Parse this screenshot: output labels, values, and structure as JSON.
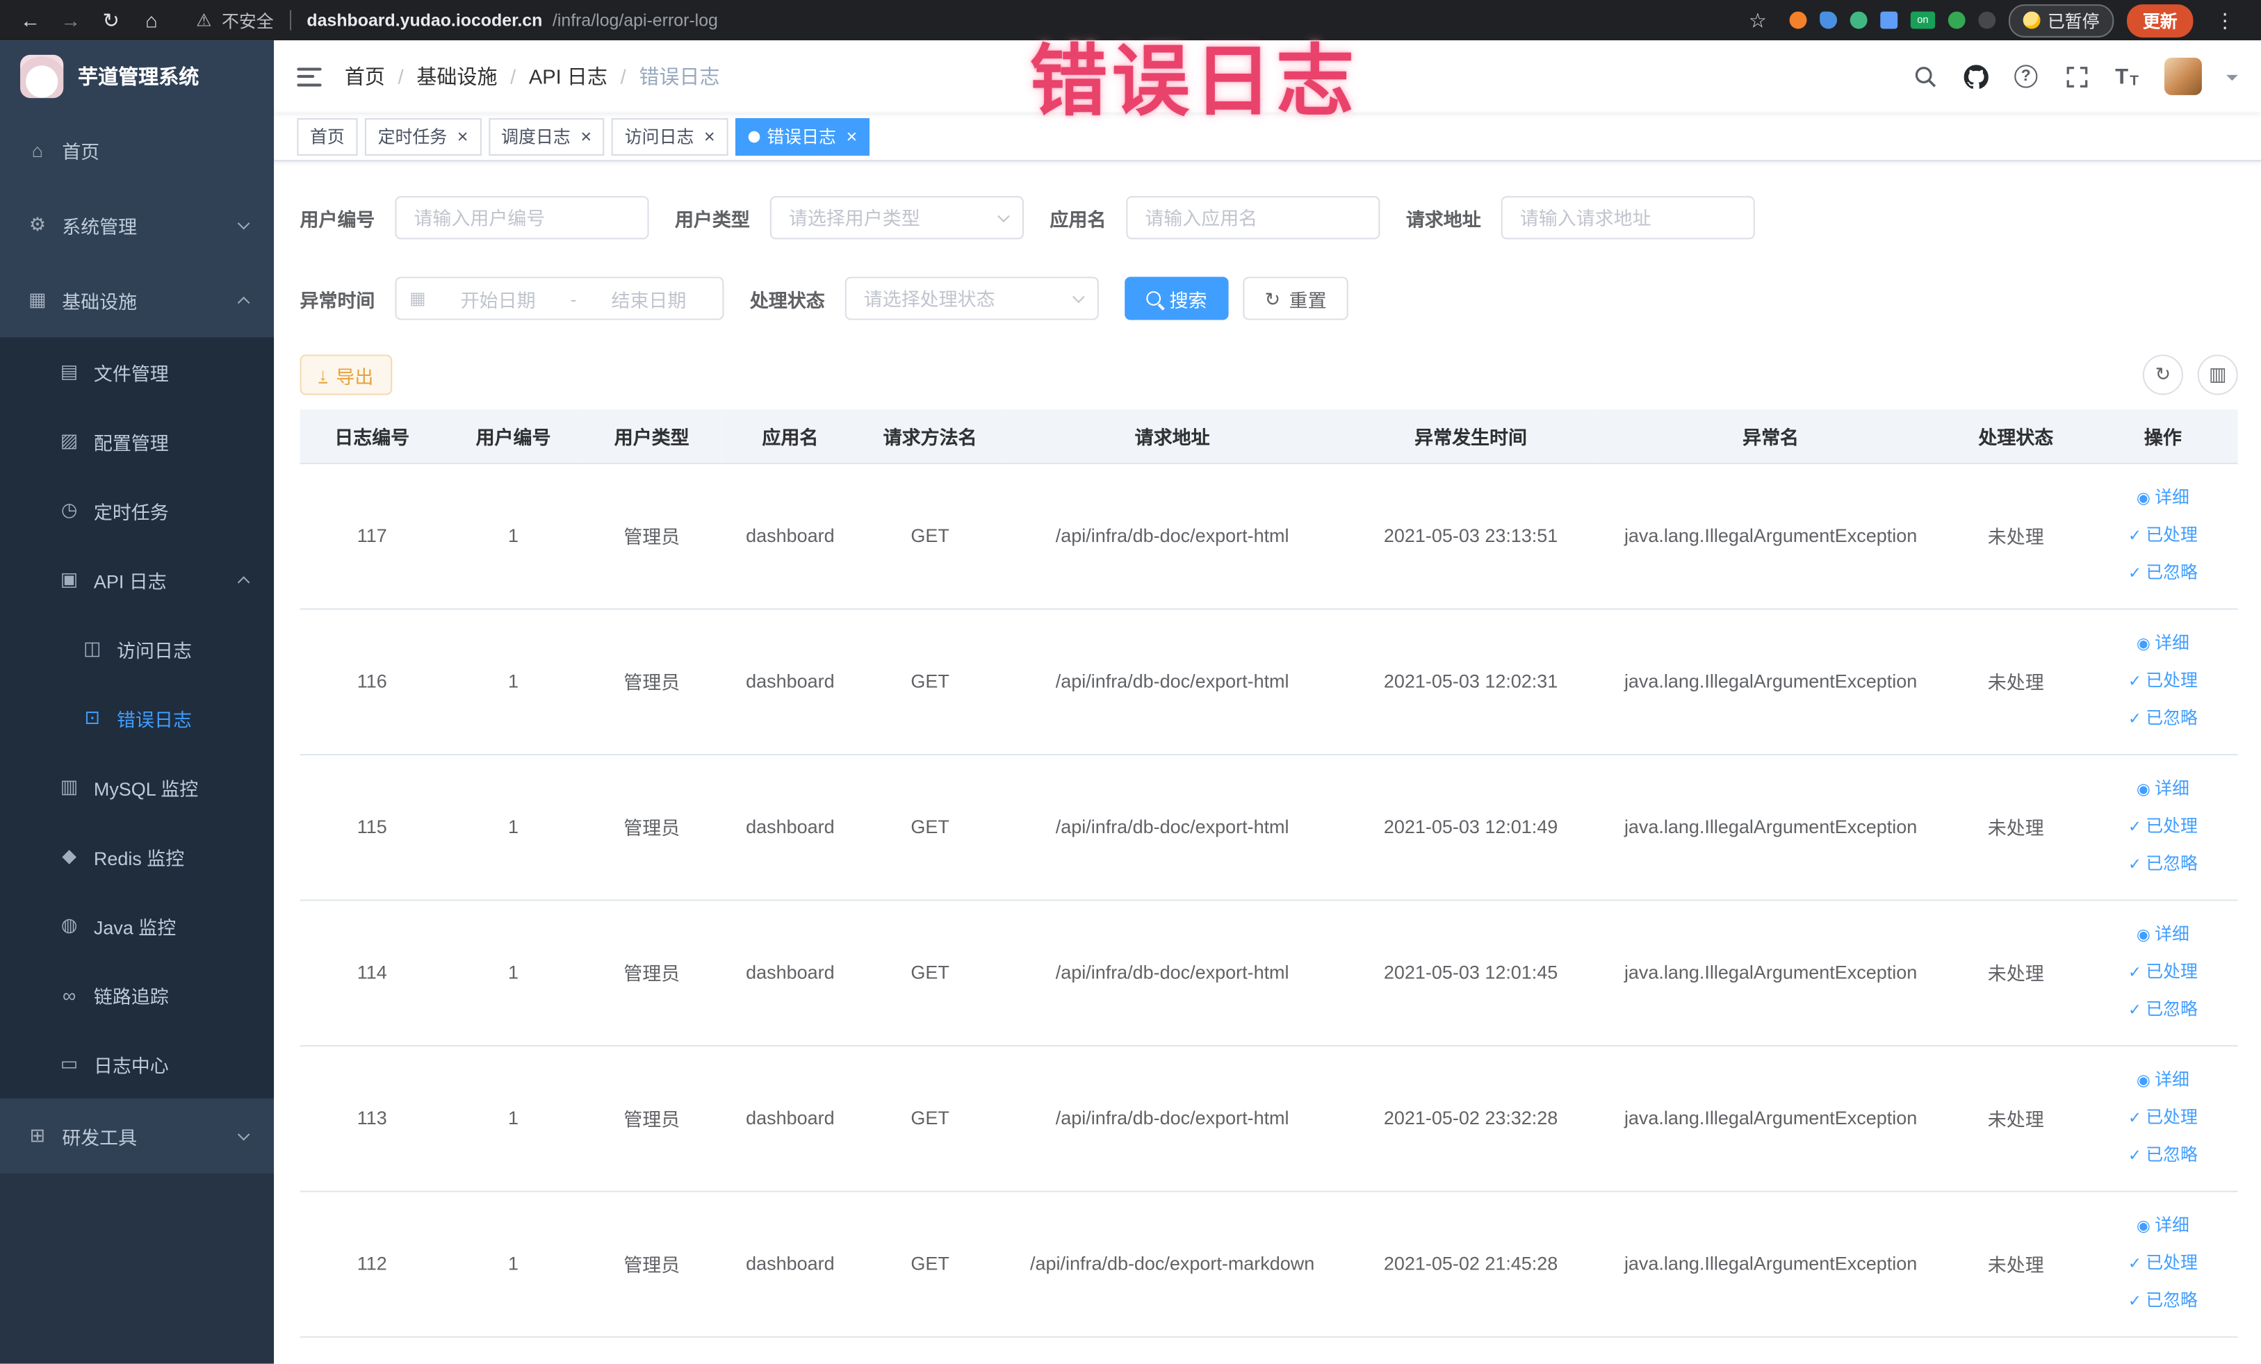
{
  "browser": {
    "security_label": "不安全",
    "url_host": "dashboard.yudao.iocoder.cn",
    "url_path": "/infra/log/api-error-log",
    "on_badge": "on",
    "paused_badge": "已暂停",
    "update_button": "更新"
  },
  "annotation": {
    "overlay_text": "错误日志"
  },
  "sidebar": {
    "logo_title": "芋道管理系统",
    "home": "首页",
    "system": "系统管理",
    "infra": "基础设施",
    "file_mgmt": "文件管理",
    "config_mgmt": "配置管理",
    "scheduled_jobs": "定时任务",
    "api_log": "API 日志",
    "access_log": "访问日志",
    "error_log": "错误日志",
    "mysql": "MySQL 监控",
    "redis": "Redis 监控",
    "java": "Java 监控",
    "tracing": "链路追踪",
    "log_center": "日志中心",
    "dev_tools": "研发工具"
  },
  "breadcrumb": {
    "b1": "首页",
    "b2": "基础设施",
    "b3": "API 日志",
    "b4": "错误日志"
  },
  "tabs": {
    "home": "首页",
    "job": "定时任务",
    "job_log": "调度日志",
    "access_log": "访问日志",
    "error_log": "错误日志"
  },
  "filters": {
    "user_id_label": "用户编号",
    "user_id_placeholder": "请输入用户编号",
    "user_type_label": "用户类型",
    "user_type_placeholder": "请选择用户类型",
    "app_name_label": "应用名",
    "app_name_placeholder": "请输入应用名",
    "request_url_label": "请求地址",
    "request_url_placeholder": "请输入请求地址",
    "exception_time_label": "异常时间",
    "date_start_placeholder": "开始日期",
    "date_range_separator": "-",
    "date_end_placeholder": "结束日期",
    "status_label": "处理状态",
    "status_placeholder": "请选择处理状态",
    "search_button": "搜索",
    "reset_button": "重置"
  },
  "toolbar": {
    "export_button": "导出"
  },
  "table": {
    "columns": [
      "日志编号",
      "用户编号",
      "用户类型",
      "应用名",
      "请求方法名",
      "请求地址",
      "异常发生时间",
      "异常名",
      "处理状态",
      "操作"
    ],
    "actions": {
      "detail": "详细",
      "processed": "已处理",
      "ignored": "已忽略"
    },
    "rows": [
      {
        "id": "117",
        "user_id": "1",
        "user_type": "管理员",
        "app": "dashboard",
        "method": "GET",
        "url": "/api/infra/db-doc/export-html",
        "time": "2021-05-03 23:13:51",
        "exception": "java.lang.IllegalArgumentException",
        "status": "未处理"
      },
      {
        "id": "116",
        "user_id": "1",
        "user_type": "管理员",
        "app": "dashboard",
        "method": "GET",
        "url": "/api/infra/db-doc/export-html",
        "time": "2021-05-03 12:02:31",
        "exception": "java.lang.IllegalArgumentException",
        "status": "未处理"
      },
      {
        "id": "115",
        "user_id": "1",
        "user_type": "管理员",
        "app": "dashboard",
        "method": "GET",
        "url": "/api/infra/db-doc/export-html",
        "time": "2021-05-03 12:01:49",
        "exception": "java.lang.IllegalArgumentException",
        "status": "未处理"
      },
      {
        "id": "114",
        "user_id": "1",
        "user_type": "管理员",
        "app": "dashboard",
        "method": "GET",
        "url": "/api/infra/db-doc/export-html",
        "time": "2021-05-03 12:01:45",
        "exception": "java.lang.IllegalArgumentException",
        "status": "未处理"
      },
      {
        "id": "113",
        "user_id": "1",
        "user_type": "管理员",
        "app": "dashboard",
        "method": "GET",
        "url": "/api/infra/db-doc/export-html",
        "time": "2021-05-02 23:32:28",
        "exception": "java.lang.IllegalArgumentException",
        "status": "未处理"
      },
      {
        "id": "112",
        "user_id": "1",
        "user_type": "管理员",
        "app": "dashboard",
        "method": "GET",
        "url": "/api/infra/db-doc/export-markdown",
        "time": "2021-05-02 21:45:28",
        "exception": "java.lang.IllegalArgumentException",
        "status": "未处理"
      }
    ]
  },
  "icons": {
    "back": "←",
    "forward": "→",
    "reload": "↻",
    "home": "⌂",
    "warning": "⚠",
    "star": "☆",
    "kebab": "⋮",
    "close": "×",
    "gear": "⚙",
    "grid": "▦",
    "file": "▤",
    "config": "▨",
    "timer": "◷",
    "apilog": "▣",
    "access": "◫",
    "errlog": "⊡",
    "mysql": "▥",
    "redis": "◆",
    "java": "◍",
    "trace": "∞",
    "logcenter": "▭",
    "devtools": "⊞",
    "calendar": "▦",
    "download": "↓",
    "refresh": "↻",
    "columns": "▥",
    "eye": "◉",
    "check": "✓",
    "question": "?",
    "font_size": "T"
  }
}
